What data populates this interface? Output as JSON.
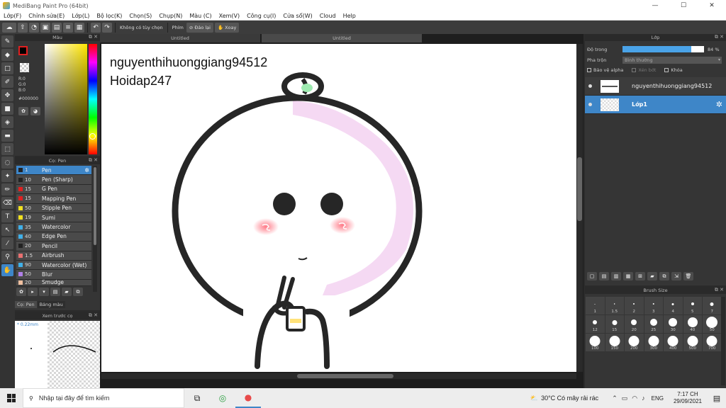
{
  "window": {
    "title": "MediBang Paint Pro (64bit)",
    "controls": {
      "minimize": "—",
      "maximize": "☐",
      "close": "✕"
    }
  },
  "menu": [
    "Lớp(F)",
    "Chỉnh sửa(E)",
    "Lớp(L)",
    "Bộ lọc(K)",
    "Chọn(S)",
    "Chụp(N)",
    "Màu (C)",
    "Xem(V)",
    "Công cụ(I)",
    "Cửa sổ(W)",
    "Cloud",
    "Help"
  ],
  "toolbar": {
    "selection_label": "Không có tùy chọn",
    "shortcut_label": "Phím",
    "reverse_label": "Đảo lại",
    "rotate_label": "Xoay"
  },
  "colors": {
    "accent": "#3e86c8",
    "foreground": "#000000",
    "panel_bg": "#353535",
    "canvas_bg": "#ffffff"
  },
  "color_panel": {
    "title": "Màu",
    "r": "R:0",
    "g": "G:0",
    "b": "B:0",
    "hex": "#000000"
  },
  "brush_panel": {
    "title": "Cọ: Pen",
    "brushes": [
      {
        "size": "1",
        "name": "Pen",
        "color": "#222222",
        "selected": true
      },
      {
        "size": "10",
        "name": "Pen (Sharp)",
        "color": "#222222",
        "selected": false
      },
      {
        "size": "15",
        "name": "G Pen",
        "color": "#e02020",
        "selected": false
      },
      {
        "size": "15",
        "name": "Mapping Pen",
        "color": "#e02020",
        "selected": false
      },
      {
        "size": "50",
        "name": "Stipple Pen",
        "color": "#f0e020",
        "selected": false
      },
      {
        "size": "19",
        "name": "Sumi",
        "color": "#f0e020",
        "selected": false
      },
      {
        "size": "35",
        "name": "Watercolor",
        "color": "#40b0e8",
        "selected": false
      },
      {
        "size": "40",
        "name": "Edge Pen",
        "color": "#40b0e8",
        "selected": false
      },
      {
        "size": "20",
        "name": "Pencil",
        "color": "#222222",
        "selected": false
      },
      {
        "size": "1.5",
        "name": "Airbrush",
        "color": "#e87070",
        "selected": false
      },
      {
        "size": "90",
        "name": "Watercolor (Wet)",
        "color": "#40b0e8",
        "selected": false
      },
      {
        "size": "50",
        "name": "Blur",
        "color": "#b080e8",
        "selected": false
      },
      {
        "size": "20",
        "name": "Smudge",
        "color": "#f0c0a0",
        "selected": false
      }
    ],
    "tabs": [
      "Cọ: Pen",
      "Bảng màu"
    ]
  },
  "preview_panel": {
    "title": "Xem trước cọ",
    "size": "* 0.22mm"
  },
  "documents": [
    "Untitled",
    "Untitled"
  ],
  "canvas": {
    "text_line1": "nguyenthihuonggiang94512",
    "text_line2": "Hoidap247"
  },
  "layer_panel": {
    "title": "Lớp",
    "opacity_label": "Độ trong",
    "opacity_value": "84 %",
    "opacity_fraction": 0.84,
    "blend_label": "Pha trộn",
    "blend_value": "Bình thường",
    "checks": [
      "Bảo vệ alpha",
      "Xén bớt",
      "Khóa"
    ],
    "layers": [
      {
        "name": "nguyenthihuonggiang94512",
        "selected": false
      },
      {
        "name": "Lớp1",
        "selected": true
      }
    ]
  },
  "size_panel": {
    "title": "Brush Size",
    "sizes": [
      "1",
      "1.5",
      "2",
      "3",
      "4",
      "5",
      "7",
      "12",
      "15",
      "20",
      "25",
      "30",
      "40",
      "50",
      "100",
      "150",
      "200",
      "300",
      "400",
      "500",
      "700"
    ]
  },
  "taskbar": {
    "search_placeholder": "Nhập tại đây để tìm kiếm",
    "weather": "30°C  Có mây rải rác",
    "language": "ENG",
    "time": "7:17 CH",
    "date": "29/09/2021"
  }
}
